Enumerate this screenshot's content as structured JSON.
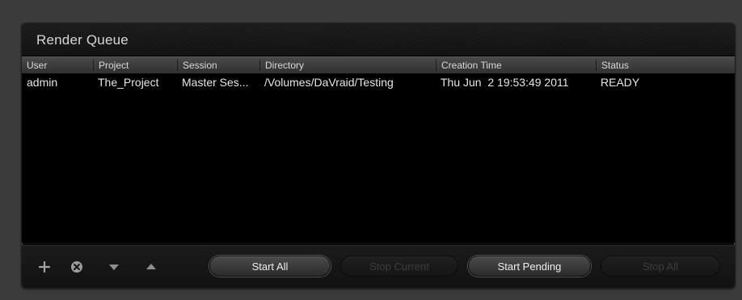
{
  "panel": {
    "title": "Render Queue"
  },
  "table": {
    "columns": [
      "User",
      "Project",
      "Session",
      "Directory",
      "Creation Time",
      "Status"
    ],
    "rows": [
      {
        "user": "admin",
        "project": "The_Project",
        "session": "Master Ses...",
        "directory": "/Volumes/DaVraid/Testing",
        "creation_time": "Thu Jun  2 19:53:49 2011",
        "status": "READY"
      }
    ]
  },
  "toolbar": {
    "icons": [
      "add-icon",
      "remove-circle-icon",
      "move-down-icon",
      "move-up-icon"
    ],
    "buttons": {
      "start_all": "Start All",
      "stop_current": "Stop Current",
      "start_pending": "Start Pending",
      "stop_all": "Stop All"
    },
    "states": {
      "start_all": "enabled",
      "stop_current": "disabled",
      "start_pending": "enabled",
      "stop_all": "disabled"
    }
  }
}
